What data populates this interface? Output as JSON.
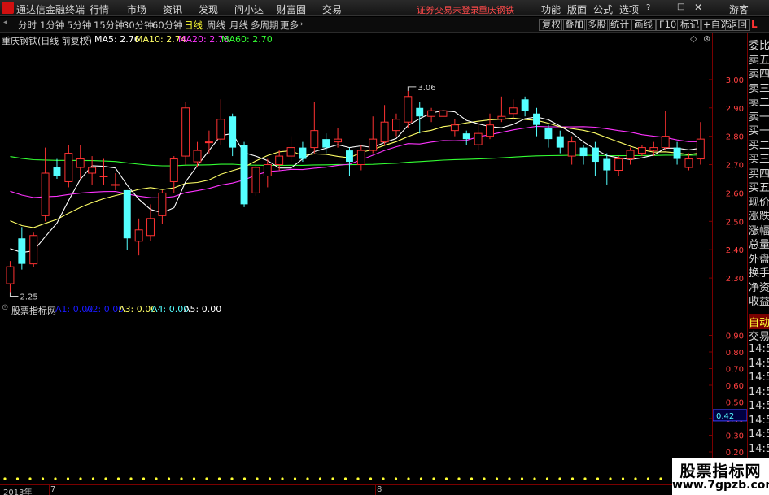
{
  "top_bar": {
    "app_title": "通达信金融终端",
    "menus": [
      "行情",
      "市场",
      "资讯",
      "发现",
      "问小达",
      "财富圈",
      "交易"
    ],
    "notice": "证券交易未登录",
    "stock_name": "重庆钢铁",
    "right_items": [
      "功能",
      "版面",
      "公式",
      "选项"
    ],
    "guest": "游客"
  },
  "period_bar": {
    "periods": [
      "分时",
      "1分钟",
      "5分钟",
      "15分钟",
      "30分钟",
      "60分钟",
      "日线",
      "周线",
      "月线",
      "多周期",
      "更多"
    ],
    "active": "日线",
    "tools": [
      "复权",
      "叠加",
      "多股",
      "统计",
      "画线",
      "F10",
      "标记",
      "+自选",
      "返回"
    ]
  },
  "main_chart": {
    "title": "重庆钢铁(日线 前复权)",
    "ma": [
      {
        "label": "MA5: 2.76",
        "color": "#ffffff"
      },
      {
        "label": "MA10: 2.74",
        "color": "#ffff66"
      },
      {
        "label": "MA20: 2.78",
        "color": "#ff33ff"
      },
      {
        "label": "MA60: 2.70",
        "color": "#33ff33"
      }
    ],
    "y_ticks": [
      "3.00",
      "2.90",
      "2.80",
      "2.70",
      "2.60",
      "2.50",
      "2.40",
      "2.30"
    ],
    "high_label": "3.06",
    "low_label": "2.25"
  },
  "chart_data": {
    "type": "candlestick",
    "ylim": [
      2.22,
      3.12
    ],
    "colors": {
      "up": "#ff3232",
      "down": "#54ffff",
      "ma5": "#ffffff",
      "ma10": "#ffff66",
      "ma20": "#ff33ff",
      "ma60": "#33ff33"
    },
    "candles": [
      [
        2.28,
        2.34,
        2.25,
        2.36
      ],
      [
        2.44,
        2.35,
        2.33,
        2.48
      ],
      [
        2.35,
        2.45,
        2.34,
        2.46
      ],
      [
        2.52,
        2.67,
        2.5,
        2.76
      ],
      [
        2.69,
        2.66,
        2.65,
        2.72
      ],
      [
        2.64,
        2.74,
        2.62,
        2.77
      ],
      [
        2.69,
        2.72,
        2.65,
        2.77
      ],
      [
        2.67,
        2.69,
        2.63,
        2.73
      ],
      [
        2.66,
        2.66,
        2.63,
        2.72
      ],
      [
        2.63,
        2.63,
        2.61,
        2.67
      ],
      [
        2.61,
        2.44,
        2.4,
        2.61
      ],
      [
        2.43,
        2.47,
        2.38,
        2.51
      ],
      [
        2.45,
        2.51,
        2.43,
        2.56
      ],
      [
        2.52,
        2.6,
        2.49,
        2.61
      ],
      [
        2.64,
        2.72,
        2.6,
        2.73
      ],
      [
        2.73,
        2.9,
        2.7,
        2.92
      ],
      [
        2.71,
        2.75,
        2.69,
        2.78
      ],
      [
        2.78,
        2.78,
        2.74,
        2.82
      ],
      [
        2.79,
        2.86,
        2.77,
        2.93
      ],
      [
        2.87,
        2.76,
        2.73,
        2.88
      ],
      [
        2.77,
        2.56,
        2.55,
        2.78
      ],
      [
        2.6,
        2.69,
        2.59,
        2.72
      ],
      [
        2.66,
        2.7,
        2.62,
        2.72
      ],
      [
        2.7,
        2.73,
        2.68,
        2.75
      ],
      [
        2.73,
        2.76,
        2.71,
        2.8
      ],
      [
        2.76,
        2.72,
        2.71,
        2.78
      ],
      [
        2.76,
        2.82,
        2.74,
        2.92
      ],
      [
        2.79,
        2.76,
        2.74,
        2.81
      ],
      [
        2.78,
        2.79,
        2.76,
        2.83
      ],
      [
        2.75,
        2.71,
        2.66,
        2.76
      ],
      [
        2.7,
        2.75,
        2.68,
        2.77
      ],
      [
        2.75,
        2.79,
        2.74,
        2.87
      ],
      [
        2.78,
        2.85,
        2.77,
        2.91
      ],
      [
        2.82,
        2.86,
        2.8,
        2.88
      ],
      [
        2.85,
        2.94,
        2.83,
        2.96
      ],
      [
        2.9,
        2.87,
        2.81,
        2.92
      ],
      [
        2.87,
        2.89,
        2.85,
        2.9
      ],
      [
        2.87,
        2.89,
        2.86,
        2.89
      ],
      [
        2.82,
        2.84,
        2.8,
        2.86
      ],
      [
        2.81,
        2.79,
        2.77,
        2.82
      ],
      [
        2.77,
        2.81,
        2.75,
        2.85
      ],
      [
        2.8,
        2.84,
        2.79,
        2.88
      ],
      [
        2.86,
        2.87,
        2.85,
        2.94
      ],
      [
        2.88,
        2.9,
        2.86,
        2.93
      ],
      [
        2.93,
        2.89,
        2.87,
        2.94
      ],
      [
        2.88,
        2.84,
        2.8,
        2.9
      ],
      [
        2.83,
        2.79,
        2.76,
        2.84
      ],
      [
        2.8,
        2.76,
        2.74,
        2.82
      ],
      [
        2.73,
        2.78,
        2.7,
        2.8
      ],
      [
        2.76,
        2.73,
        2.7,
        2.77
      ],
      [
        2.76,
        2.71,
        2.66,
        2.78
      ],
      [
        2.72,
        2.68,
        2.63,
        2.74
      ],
      [
        2.68,
        2.72,
        2.66,
        2.73
      ],
      [
        2.72,
        2.75,
        2.7,
        2.76
      ],
      [
        2.74,
        2.76,
        2.73,
        2.77
      ],
      [
        2.75,
        2.76,
        2.73,
        2.78
      ],
      [
        2.76,
        2.8,
        2.75,
        2.89
      ],
      [
        2.76,
        2.72,
        2.7,
        2.78
      ],
      [
        2.69,
        2.72,
        2.68,
        2.74
      ],
      [
        2.72,
        2.79,
        2.7,
        2.85
      ]
    ]
  },
  "sub_chart": {
    "name": "股票指标网",
    "series": [
      {
        "label": "A1: 0.00",
        "color": "#1a1aff"
      },
      {
        "label": "A2: 0.00",
        "color": "#1a1aff"
      },
      {
        "label": "A3: 0.00",
        "color": "#ffff66"
      },
      {
        "label": "A4: 0.00",
        "color": "#54ffff"
      },
      {
        "label": "A5: 0.00",
        "color": "#ffffff"
      }
    ],
    "y_ticks": [
      "0.90",
      "0.80",
      "0.70",
      "0.60",
      "0.50",
      "0.40",
      "0.30",
      "0.20",
      "0.10"
    ],
    "cursor_value": "0.42"
  },
  "time_axis": {
    "year_label": "2013年",
    "month1": "7",
    "month2": "8"
  },
  "sidebar": {
    "top": "L",
    "items": [
      "委比",
      "卖五",
      "卖四",
      "卖三",
      "卖二",
      "卖一",
      "买一",
      "买二",
      "买三",
      "买四",
      "买五",
      "现价",
      "涨跌",
      "涨幅",
      "总量",
      "外盘",
      "换手",
      "净资",
      "收益"
    ],
    "auto": "自动",
    "trade": "交易",
    "times": [
      "14:56",
      "14:56",
      "14:56",
      "14:56",
      "14:56",
      "14:56",
      "14:56",
      "14:56",
      "14:56",
      "14:56",
      "14:56"
    ]
  },
  "watermark": {
    "cn": "股票指标网",
    "url": "www.7gpzb.com"
  }
}
